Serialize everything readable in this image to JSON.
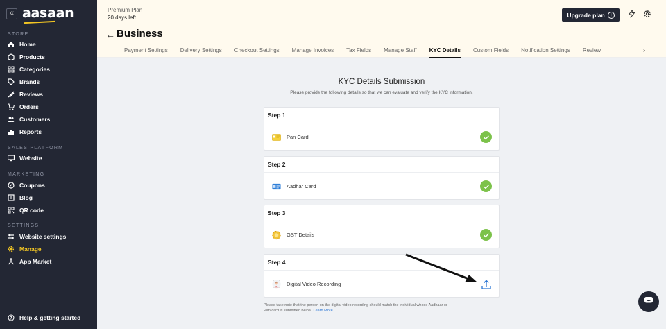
{
  "app": {
    "logo": "aasaan",
    "collapse_glyph": "«"
  },
  "sidebar": {
    "sections": [
      {
        "label": "STORE"
      },
      {
        "label": "SALES PLATFORM"
      },
      {
        "label": "MARKETING"
      },
      {
        "label": "SETTINGS"
      }
    ],
    "items": [
      {
        "label": "Home",
        "icon": "home-icon"
      },
      {
        "label": "Products",
        "icon": "box-icon"
      },
      {
        "label": "Categories",
        "icon": "grid-icon"
      },
      {
        "label": "Brands",
        "icon": "tag-icon"
      },
      {
        "label": "Reviews",
        "icon": "thumb-icon"
      },
      {
        "label": "Orders",
        "icon": "cart-icon"
      },
      {
        "label": "Customers",
        "icon": "users-icon"
      },
      {
        "label": "Reports",
        "icon": "chart-icon"
      },
      {
        "label": "Website",
        "icon": "monitor-icon"
      },
      {
        "label": "Coupons",
        "icon": "coupon-icon"
      },
      {
        "label": "Blog",
        "icon": "blog-icon"
      },
      {
        "label": "QR code",
        "icon": "qr-icon"
      },
      {
        "label": "Website settings",
        "icon": "sliders-icon"
      },
      {
        "label": "Manage",
        "icon": "gear-icon",
        "active": true
      },
      {
        "label": "App Market",
        "icon": "apps-icon"
      }
    ],
    "help": {
      "label": "Help & getting started",
      "icon": "help-icon"
    }
  },
  "topbar": {
    "plan_name": "Premium Plan",
    "plan_days": "20 days left",
    "upgrade_label": "Upgrade plan",
    "page_title": "Business",
    "tabs": [
      {
        "label": "Payment Settings"
      },
      {
        "label": "Delivery Settings"
      },
      {
        "label": "Checkout Settings"
      },
      {
        "label": "Manage Invoices"
      },
      {
        "label": "Tax Fields"
      },
      {
        "label": "Manage Staff"
      },
      {
        "label": "KYC Details",
        "active": true
      },
      {
        "label": "Custom Fields"
      },
      {
        "label": "Notification Settings"
      },
      {
        "label": "Review"
      }
    ]
  },
  "kyc": {
    "title": "KYC Details Submission",
    "subtitle": "Please provide the following details so that we can evaluate and verify the KYC information.",
    "steps": [
      {
        "step": "Step 1",
        "label": "Pan Card",
        "status": "completed",
        "icon": "pan-card-icon"
      },
      {
        "step": "Step 2",
        "label": "Aadhar Card",
        "status": "completed",
        "icon": "aadhar-card-icon"
      },
      {
        "step": "Step 3",
        "label": "GST Details",
        "status": "completed",
        "icon": "gst-badge-icon"
      },
      {
        "step": "Step 4",
        "label": "Digital Video Recording",
        "status": "pending-upload",
        "icon": "video-avatar-icon"
      }
    ],
    "note_line1": "Please take note that the person on the digital video recording should match the individual whose Aadhaar or",
    "note_line2": "Pan card is submitted below.",
    "learn_more": "Learn More"
  },
  "colors": {
    "sidebar_bg": "#232734",
    "accent_yellow": "#f3c623",
    "topbar_bg": "#fffaee",
    "main_bg": "#eff1f4",
    "success_green": "#7cc24a",
    "link_blue": "#2d77d4"
  }
}
